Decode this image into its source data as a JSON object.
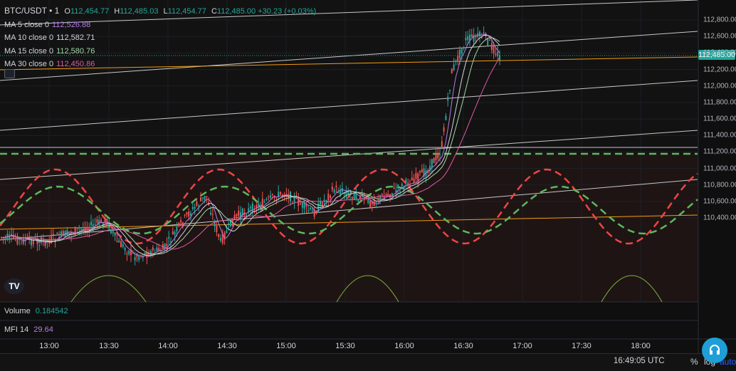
{
  "symbol": "BTC/USDT • 1",
  "ohlc": {
    "o_label": "O",
    "o": "112,454.77",
    "h_label": "H",
    "h": "112,485.03",
    "l_label": "L",
    "l": "112,454.77",
    "c_label": "C",
    "c": "112,485.00",
    "change": "+30.23 (+0.03%)"
  },
  "ma_rows": [
    {
      "label": "MA 5 close 0",
      "value": "112,526.88",
      "color": "#b57ce8"
    },
    {
      "label": "MA 10 close 0",
      "value": "112,582.71",
      "color": "#d1d4dc"
    },
    {
      "label": "MA 15 close 0",
      "value": "112,580.76",
      "color": "#a5d6a7"
    },
    {
      "label": "MA 30 close 0",
      "value": "112,450.86",
      "color": "#e05aa5"
    }
  ],
  "last_price": "112,485.00",
  "price_axis": [
    "112,800.00",
    "112,600.00",
    "112,400.00",
    "112,200.00",
    "112,000.00",
    "111,800.00",
    "111,600.00",
    "111,400.00",
    "111,200.00",
    "111,000.00",
    "110,800.00",
    "110,600.00",
    "110,400.00"
  ],
  "time_axis": [
    "13:00",
    "13:30",
    "14:00",
    "14:30",
    "15:00",
    "15:30",
    "16:00",
    "16:30",
    "17:00",
    "17:30",
    "18:00"
  ],
  "volume": {
    "label": "Volume",
    "value": "0.184542"
  },
  "mfi": {
    "label": "MFI 14",
    "value": "29.64"
  },
  "footer": {
    "clock": "16:49:05 UTC",
    "percent": "%",
    "log": "log",
    "auto": "auto"
  },
  "icons": {
    "logo": "tradingview-logo-icon",
    "help": "headset-icon",
    "collapse": "collapse-legend-icon"
  },
  "colors": {
    "up": "#26a69a",
    "down": "#ef5350",
    "background": "#0f0f0f",
    "accent": "#2962ff"
  },
  "chart_data": {
    "type": "candlestick",
    "title": "",
    "xlabel": "",
    "ylabel": "",
    "x_range": [
      "12:45",
      "18:30"
    ],
    "ylim": [
      110300,
      112900
    ],
    "ma_latest": {
      "MA 5": 112526.88,
      "MA 10": 112582.71,
      "MA 15": 112580.76,
      "MA 30": 112450.86
    },
    "last_close": 112485.0
  }
}
